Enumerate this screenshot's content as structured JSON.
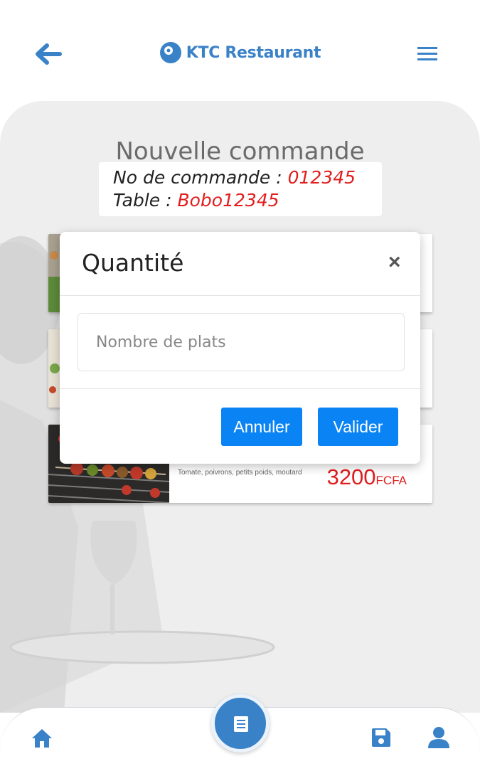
{
  "header": {
    "brand": "KTC Restaurant",
    "back_icon": "arrow-left-icon",
    "menu_icon": "hamburger-menu-icon"
  },
  "page": {
    "title": "Nouvelle commande",
    "order_label": "No de commande : ",
    "order_number": "012345",
    "table_label": "Table : ",
    "table_value": "Bobo12345"
  },
  "menu_items": [
    {
      "description": "",
      "price": "",
      "currency": ""
    },
    {
      "description": "",
      "price": "",
      "currency": ""
    },
    {
      "description": "Tomate, poivrons, petits poids, moutard",
      "price": "3200",
      "currency": "FCFA"
    }
  ],
  "dialog": {
    "title": "Quantité",
    "close_label": "×",
    "input_placeholder": "Nombre de plats",
    "input_value": "",
    "cancel_label": "Annuler",
    "confirm_label": "Valider"
  },
  "bottom_nav": {
    "items": [
      "home-icon",
      "menu-book-icon",
      "save-icon",
      "user-icon"
    ]
  },
  "colors": {
    "accent": "#3a82c8",
    "button": "#0a84f5",
    "highlight": "#e01e1e",
    "panel_bg": "#eeeeee"
  }
}
